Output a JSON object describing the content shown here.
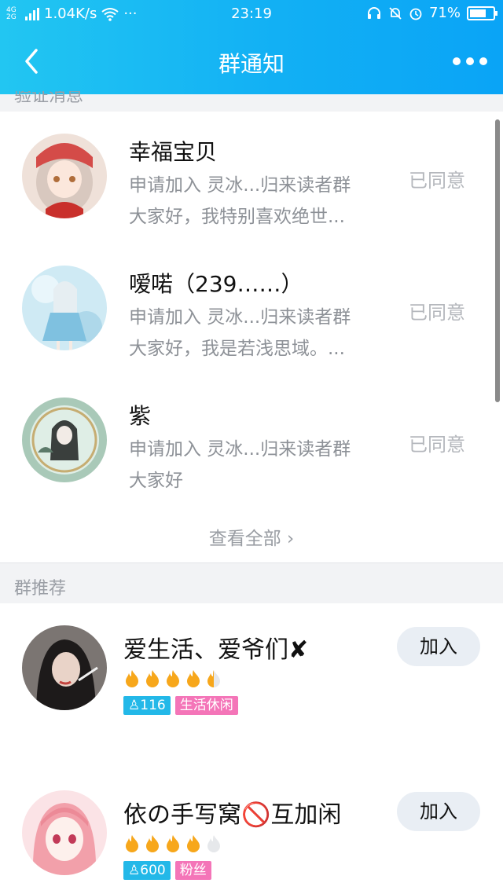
{
  "status_bar": {
    "network_type": "4G 2G",
    "speed": "1.04K/s",
    "dots": "···",
    "time": "23:19",
    "battery_text": "71%",
    "battery_level": 0.71
  },
  "nav": {
    "title": "群通知",
    "icons": [
      "back-icon",
      "more-icon"
    ]
  },
  "sections": {
    "verify_label": "验证消息",
    "recommend_label": "群推荐"
  },
  "requests": [
    {
      "name": "幸福宝贝",
      "line1": "申请加入 灵冰...归来读者群",
      "line2": "大家好，我特别喜欢绝世...",
      "state": "已同意"
    },
    {
      "name": "嗳喏（239……）",
      "line1": "申请加入 灵冰...归来读者群",
      "line2": "大家好，我是若浅思域。...",
      "state": "已同意"
    },
    {
      "name": "紫",
      "line1": "申请加入 灵冰...归来读者群",
      "line2": "大家好",
      "state": "已同意"
    }
  ],
  "view_all": "查看全部 ›",
  "groups": [
    {
      "name": "爱生活、爱爷们✘",
      "heat": 4.5,
      "members": "116",
      "category": "生活休闲",
      "join_label": "加入"
    },
    {
      "name": "依の手写窝🚫互加闲",
      "heat": 4,
      "members": "600",
      "category": "粉丝",
      "join_label": "加入"
    }
  ],
  "colors": {
    "header": "#12b0f4",
    "tag_count": "#23b8e8",
    "tag_category": "#f475b8",
    "flame": "#f7a71b"
  }
}
